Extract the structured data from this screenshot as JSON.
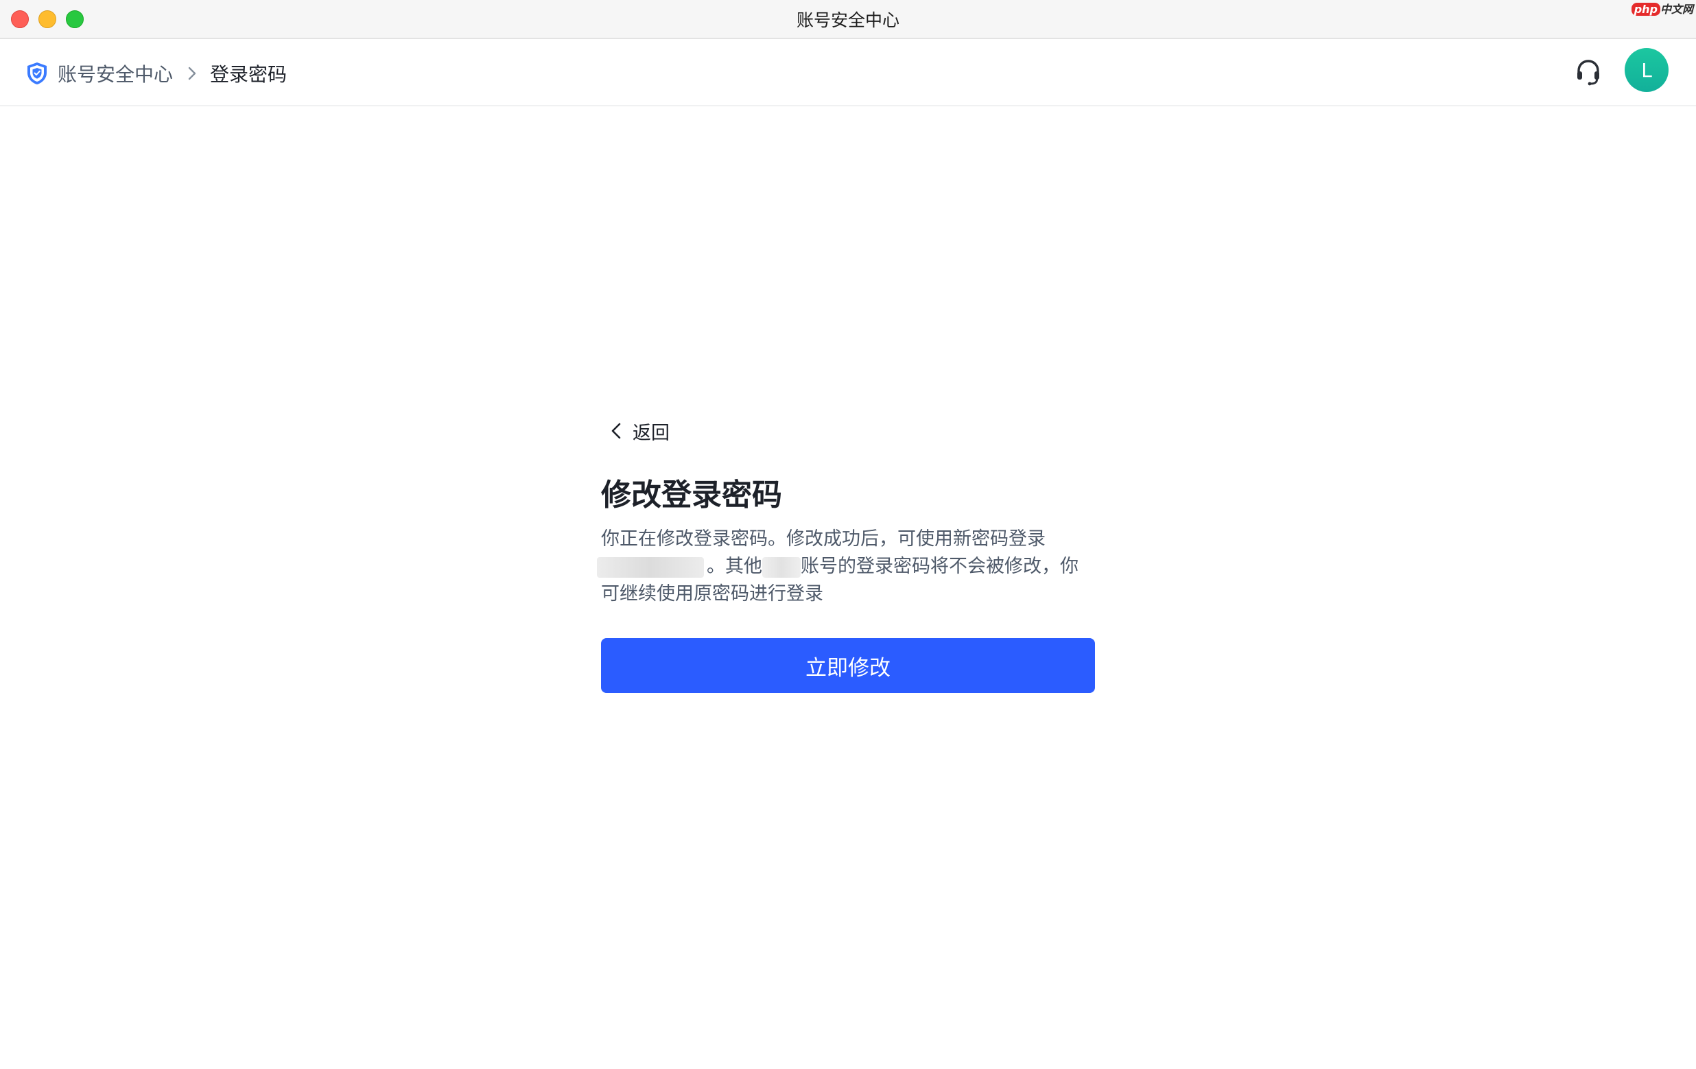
{
  "window": {
    "title": "账号安全中心",
    "watermark_php": "php",
    "watermark_cn": "中文网"
  },
  "header": {
    "breadcrumb_root": "账号安全中心",
    "breadcrumb_current": "登录密码",
    "avatar_initial": "L",
    "icons": [
      "shield-icon",
      "chevron-right-icon",
      "headset-icon"
    ]
  },
  "main": {
    "back_label": "返回",
    "title": "修改登录密码",
    "desc_part1": "你正在修改登录密码。修改成功后，可使用新密码登录",
    "desc_part2": "。其他",
    "desc_part3": "账号的登录密码将不会被修改，你可继续使用原密码进行登录",
    "button_label": "立即修改"
  },
  "colors": {
    "primary": "#2b5cff",
    "avatar": "#14b8a6",
    "shield": "#3b7bff"
  }
}
